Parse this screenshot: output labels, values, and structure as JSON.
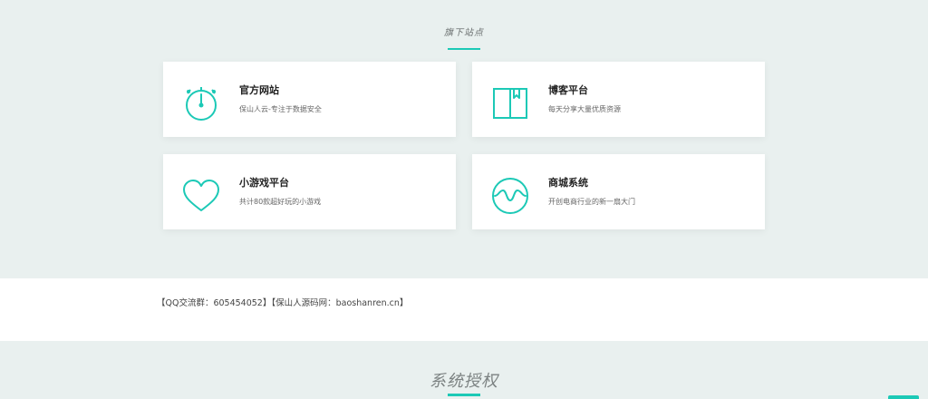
{
  "section": {
    "title": "旗下站点"
  },
  "cards": [
    {
      "title": "官方网站",
      "desc": "保山人云-专注于数据安全",
      "icon": "stopwatch-icon"
    },
    {
      "title": "博客平台",
      "desc": "每天分享大量优质资源",
      "icon": "book-icon"
    },
    {
      "title": "小游戏平台",
      "desc": "共计80款超好玩的小游戏",
      "icon": "heart-icon"
    },
    {
      "title": "商城系统",
      "desc": "开创电商行业的新一扇大门",
      "icon": "wave-circle-icon"
    }
  ],
  "footer": {
    "text": "【QQ交流群：605454052】【保山人源码网：baoshanren.cn】"
  },
  "next_section": {
    "title": "系统授权"
  },
  "colors": {
    "accent": "#1cc9b6",
    "background": "#e9f0ef",
    "card": "#ffffff"
  }
}
